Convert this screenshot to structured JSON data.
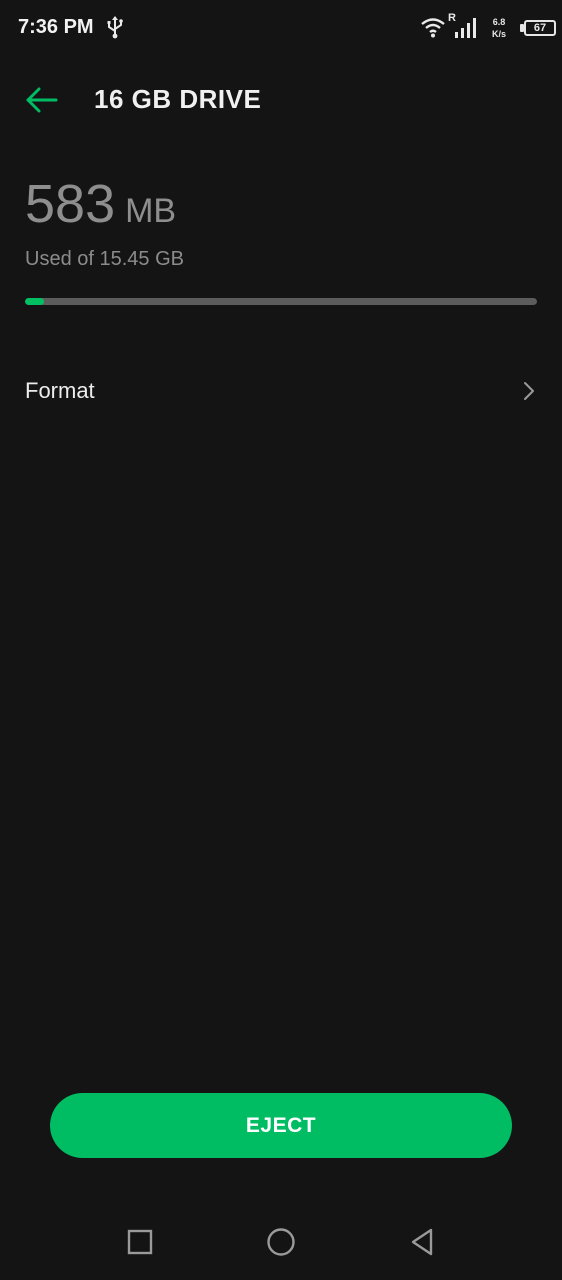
{
  "status_bar": {
    "time": "7:36 PM",
    "usb_icon": "usb-icon",
    "wifi_icon": "wifi-icon",
    "roaming_flag": "R",
    "signal_icon": "cellular-signal-icon",
    "net_speed_value": "6.8",
    "net_speed_unit": "K/s",
    "battery_level": "67"
  },
  "header": {
    "back_icon": "back-arrow-icon",
    "title": "16 GB DRIVE"
  },
  "storage": {
    "used_value": "583",
    "used_unit": "MB",
    "caption": "Used of 15.45 GB",
    "used_fraction": 0.0369
  },
  "options": [
    {
      "label": "Format",
      "icon": "chevron-right-icon"
    }
  ],
  "actions": {
    "eject_label": "EJECT"
  },
  "nav_bar": {
    "recents_icon": "square-recents-icon",
    "home_icon": "circle-home-icon",
    "back_icon": "triangle-back-icon"
  },
  "colors": {
    "accent": "#00BD63",
    "background": "#141414",
    "track": "#5C5C5C"
  }
}
